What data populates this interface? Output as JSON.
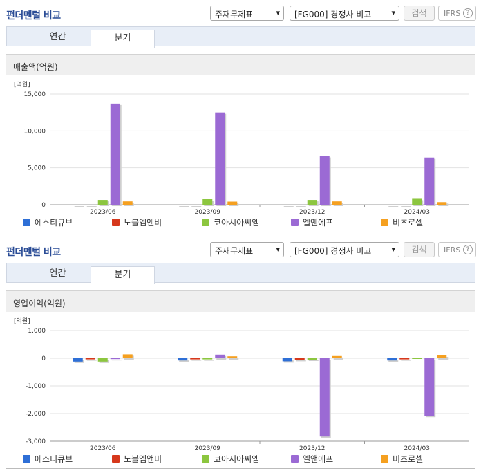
{
  "colors": {
    "title": "#2a4c96",
    "series": [
      "#2e6fd6",
      "#d6381c",
      "#8cc63f",
      "#9b6ad4",
      "#f5a020"
    ]
  },
  "legend": [
    "에스티큐브",
    "노블엠앤비",
    "코아시아씨엠",
    "엘앤에프",
    "비츠로셀"
  ],
  "panels": [
    {
      "title": "펀더멘털 비교",
      "select1": "주재무제표",
      "select2": "[FG000] 경쟁사 비교",
      "search_label": "검색",
      "ifrs_label": "IFRS",
      "tabs": [
        "연간",
        "분기"
      ],
      "metric_label": "매출액(억원)"
    },
    {
      "title": "펀더멘털 비교",
      "select1": "주재무제표",
      "select2": "[FG000] 경쟁사 비교",
      "search_label": "검색",
      "ifrs_label": "IFRS",
      "tabs": [
        "연간",
        "분기"
      ],
      "metric_label": "영업이익(억원)"
    }
  ],
  "chart_data": [
    {
      "type": "bar",
      "unit_label": "[억원]",
      "categories": [
        "2023/06",
        "2023/09",
        "2023/12",
        "2024/03"
      ],
      "ylim": [
        0,
        15000
      ],
      "yticks": [
        0,
        5000,
        10000,
        15000
      ],
      "ytick_labels": [
        "0",
        "5,000",
        "10,000",
        "15,000"
      ],
      "series": [
        {
          "name": "에스티큐브",
          "values": [
            0,
            0,
            0,
            0
          ]
        },
        {
          "name": "노블엠앤비",
          "values": [
            0,
            0,
            0,
            0
          ]
        },
        {
          "name": "코아시아씨엠",
          "values": [
            650,
            750,
            650,
            800
          ]
        },
        {
          "name": "엘앤에프",
          "values": [
            13700,
            12500,
            6600,
            6400
          ]
        },
        {
          "name": "비츠로셀",
          "values": [
            450,
            420,
            450,
            350
          ]
        }
      ]
    },
    {
      "type": "bar",
      "unit_label": "[억원]",
      "categories": [
        "2023/06",
        "2023/09",
        "2023/12",
        "2024/03"
      ],
      "ylim": [
        -3000,
        1000
      ],
      "yticks": [
        -3000,
        -2000,
        -1000,
        0,
        1000
      ],
      "ytick_labels": [
        "-3,000",
        "-2,000",
        "-1,000",
        "0",
        "1,000"
      ],
      "series": [
        {
          "name": "에스티큐브",
          "values": [
            -120,
            -80,
            -110,
            -80
          ]
        },
        {
          "name": "노블엠앤비",
          "values": [
            -40,
            -40,
            -60,
            -40
          ]
        },
        {
          "name": "코아시아씨엠",
          "values": [
            -120,
            -40,
            -50,
            0
          ]
        },
        {
          "name": "엘앤에프",
          "values": [
            -30,
            130,
            -2830,
            -2080
          ]
        },
        {
          "name": "비츠로셀",
          "values": [
            140,
            70,
            80,
            100
          ]
        }
      ]
    }
  ]
}
